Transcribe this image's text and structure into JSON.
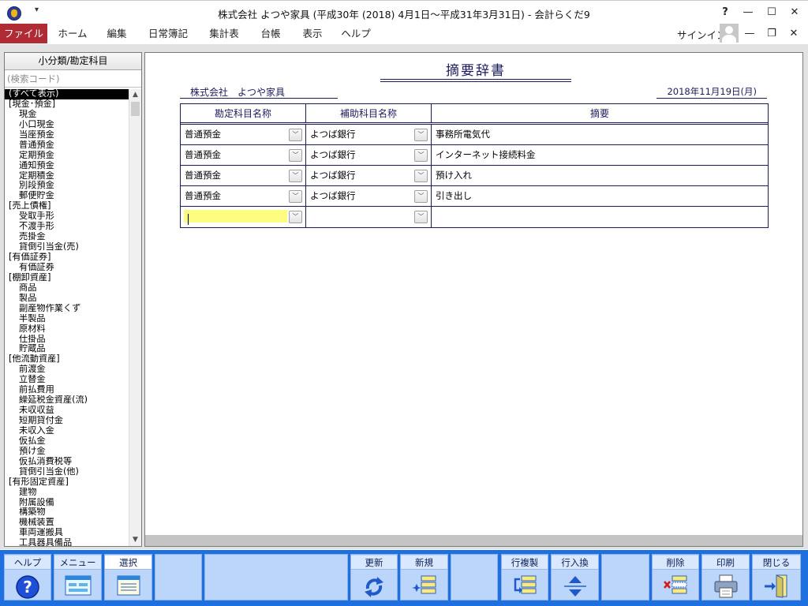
{
  "window": {
    "title": "株式会社 よつや家具 (平成30年 (2018) 4月1日～平成31年3月31日) - 会計らくだ9",
    "qat_arrow": "▾",
    "help": "?",
    "minimize": "—",
    "maximize": "☐",
    "close": "✕"
  },
  "menu": {
    "items": [
      "ファイル",
      "ホーム",
      "編集",
      "日常簿記",
      "集計表",
      "台帳",
      "表示",
      "ヘルプ"
    ],
    "signin": "サインイン",
    "mdi_min": "—",
    "mdi_restore": "❐",
    "mdi_close": "✕"
  },
  "left_panel": {
    "header": "小分類/勘定科目",
    "search_placeholder": "(検索コード)",
    "items": [
      {
        "label": "(すべて表示)",
        "type": "sel"
      },
      {
        "label": "[現金･預金]",
        "type": "group"
      },
      {
        "label": "現金",
        "type": "child"
      },
      {
        "label": "小口現金",
        "type": "child"
      },
      {
        "label": "当座預金",
        "type": "child"
      },
      {
        "label": "普通預金",
        "type": "child"
      },
      {
        "label": "定期預金",
        "type": "child"
      },
      {
        "label": "通知預金",
        "type": "child"
      },
      {
        "label": "定期積金",
        "type": "child"
      },
      {
        "label": "別段預金",
        "type": "child"
      },
      {
        "label": "郵便貯金",
        "type": "child"
      },
      {
        "label": "[売上債権]",
        "type": "group"
      },
      {
        "label": "受取手形",
        "type": "child"
      },
      {
        "label": "不渡手形",
        "type": "child"
      },
      {
        "label": "売掛金",
        "type": "child"
      },
      {
        "label": "貸倒引当金(売)",
        "type": "child"
      },
      {
        "label": "[有価証券]",
        "type": "group"
      },
      {
        "label": "有価証券",
        "type": "child"
      },
      {
        "label": "[棚卸資産]",
        "type": "group"
      },
      {
        "label": "商品",
        "type": "child"
      },
      {
        "label": "製品",
        "type": "child"
      },
      {
        "label": "副産物作業くず",
        "type": "child"
      },
      {
        "label": "半製品",
        "type": "child"
      },
      {
        "label": "原材料",
        "type": "child"
      },
      {
        "label": "仕掛品",
        "type": "child"
      },
      {
        "label": "貯蔵品",
        "type": "child"
      },
      {
        "label": "[他流動資産]",
        "type": "group"
      },
      {
        "label": "前渡金",
        "type": "child"
      },
      {
        "label": "立替金",
        "type": "child"
      },
      {
        "label": "前払費用",
        "type": "child"
      },
      {
        "label": "繰延税金資産(流)",
        "type": "child"
      },
      {
        "label": "未収収益",
        "type": "child"
      },
      {
        "label": "短期貸付金",
        "type": "child"
      },
      {
        "label": "未収入金",
        "type": "child"
      },
      {
        "label": "仮払金",
        "type": "child"
      },
      {
        "label": "預け金",
        "type": "child"
      },
      {
        "label": "仮払消費税等",
        "type": "child"
      },
      {
        "label": "貸倒引当金(他)",
        "type": "child"
      },
      {
        "label": "[有形固定資産]",
        "type": "group"
      },
      {
        "label": "建物",
        "type": "child"
      },
      {
        "label": "附属設備",
        "type": "child"
      },
      {
        "label": "構築物",
        "type": "child"
      },
      {
        "label": "機械装置",
        "type": "child"
      },
      {
        "label": "車両運搬具",
        "type": "child"
      },
      {
        "label": "工具器具備品",
        "type": "child"
      }
    ]
  },
  "main": {
    "title": "摘要辞書",
    "company": "株式会社　よつや家具",
    "date": "2018年11月19日(月)",
    "columns": [
      "勘定科目名称",
      "補助科目名称",
      "摘要"
    ],
    "rows": [
      {
        "account": "普通預金",
        "sub": "よつば銀行",
        "memo": "事務所電気代"
      },
      {
        "account": "普通預金",
        "sub": "よつば銀行",
        "memo": "インターネット接続料金"
      },
      {
        "account": "普通預金",
        "sub": "よつば銀行",
        "memo": "預け入れ"
      },
      {
        "account": "普通預金",
        "sub": "よつば銀行",
        "memo": "引き出し"
      }
    ]
  },
  "toolbar": {
    "help": "ヘルプ",
    "menu": "メニュー",
    "select": "選択",
    "update": "更新",
    "new": "新規",
    "copy_row": "行複製",
    "swap_row": "行入換",
    "delete": "削除",
    "print": "印刷",
    "close": "閉じる"
  },
  "colors": {
    "menu_file_bg": "#b02b33",
    "toolbar_bg": "#1e6fe0",
    "button_bg": "#bcd6fb",
    "table_line": "#1b1b5e",
    "input_highlight": "#fffd80"
  }
}
